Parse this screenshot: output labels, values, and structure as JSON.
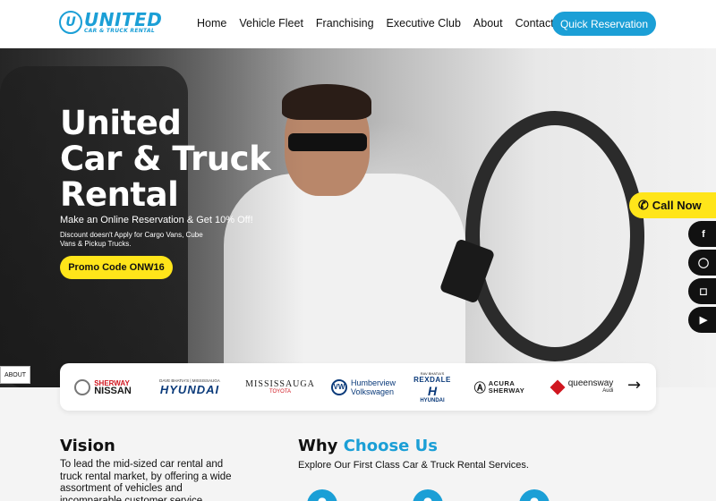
{
  "brand": {
    "logo_word": "UNITED",
    "logo_sub": "CAR & TRUCK RENTAL",
    "logo_mark": "U"
  },
  "nav": {
    "items": [
      "Home",
      "Vehicle Fleet",
      "Franchising",
      "Executive Club",
      "About",
      "Contact"
    ],
    "cta": "Quick Reservation"
  },
  "hero": {
    "title_lines": [
      "United",
      "Car & Truck",
      "Rental"
    ],
    "subtitle": "Make an Online Reservation & Get 10% Off!",
    "note": "Discount doesn't Apply for Cargo Vans, Cube Vans & Pickup Trucks.",
    "promo": "Promo Code ONW16"
  },
  "floating": {
    "call_now": "Call Now",
    "social": [
      {
        "name": "facebook-icon",
        "glyph": "f"
      },
      {
        "name": "whatsapp-icon",
        "glyph": "◯"
      },
      {
        "name": "instagram-icon",
        "glyph": "◻"
      },
      {
        "name": "youtube-icon",
        "glyph": "▶"
      }
    ],
    "about_tab": "ABOUT"
  },
  "brands": {
    "nissan": {
      "line1": "SHERWAY",
      "line2": "NISSAN"
    },
    "hyundai": {
      "top": "DAVE BHATIA'S | MISSISSAUGA",
      "name": "HYUNDAI"
    },
    "mississauga": {
      "name": "MISSISSAUGA",
      "sub": "TOYOTA"
    },
    "humberview": {
      "line1": "Humberview",
      "line2": "Volkswagen"
    },
    "rexdale": {
      "top": "RAV BHATIA'S",
      "name": "REXDALE",
      "sub": "HYUNDAI"
    },
    "acura": {
      "line1": "ACURA",
      "line2": "SHERWAY"
    },
    "queensway": {
      "name": "queensway",
      "sub": "Audi"
    },
    "next_arrow": "→"
  },
  "vision": {
    "title": "Vision",
    "text": "To lead the mid-sized car rental and truck rental market, by offering a wide assortment of vehicles and incomparable customer service."
  },
  "why": {
    "title_plain": "Why",
    "title_accent": "Choose Us",
    "subtitle": "Explore Our First Class Car & Truck Rental Services."
  },
  "colors": {
    "accent": "#1b9fd6",
    "yellow": "#ffe51a",
    "dark": "#111111"
  }
}
